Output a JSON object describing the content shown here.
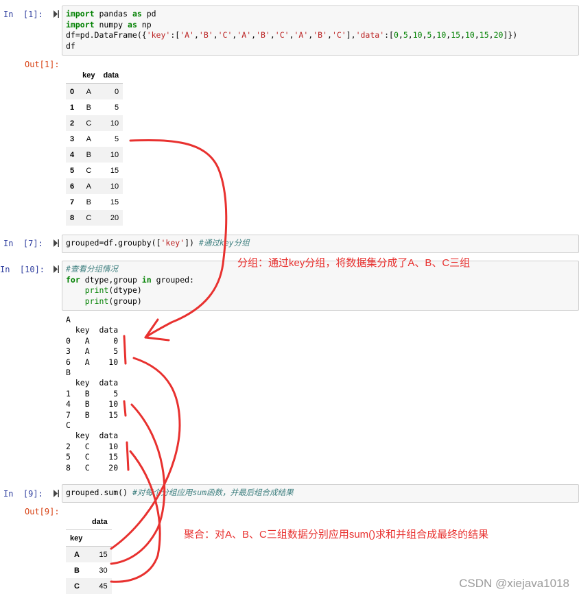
{
  "cells": [
    {
      "prompt": "In  [1]:",
      "code": [
        [
          [
            "kw",
            "import"
          ],
          [
            "t",
            " pandas "
          ],
          [
            "kw",
            "as"
          ],
          [
            "t",
            " pd"
          ]
        ],
        [
          [
            "kw",
            "import"
          ],
          [
            "t",
            " numpy "
          ],
          [
            "kw",
            "as"
          ],
          [
            "t",
            " np"
          ]
        ],
        [
          [
            "t",
            "df=pd.DataFrame({"
          ],
          [
            "str",
            "'key'"
          ],
          [
            "t",
            ":["
          ],
          [
            "str",
            "'A'"
          ],
          [
            "t",
            ","
          ],
          [
            "str",
            "'B'"
          ],
          [
            "t",
            ","
          ],
          [
            "str",
            "'C'"
          ],
          [
            "t",
            ","
          ],
          [
            "str",
            "'A'"
          ],
          [
            "t",
            ","
          ],
          [
            "str",
            "'B'"
          ],
          [
            "t",
            ","
          ],
          [
            "str",
            "'C'"
          ],
          [
            "t",
            ","
          ],
          [
            "str",
            "'A'"
          ],
          [
            "t",
            ","
          ],
          [
            "str",
            "'B'"
          ],
          [
            "t",
            ","
          ],
          [
            "str",
            "'C'"
          ],
          [
            "t",
            "],"
          ],
          [
            "str",
            "'data'"
          ],
          [
            "t",
            ":["
          ],
          [
            "num",
            "0"
          ],
          [
            "t",
            ","
          ],
          [
            "num",
            "5"
          ],
          [
            "t",
            ","
          ],
          [
            "num",
            "10"
          ],
          [
            "t",
            ","
          ],
          [
            "num",
            "5"
          ],
          [
            "t",
            ","
          ],
          [
            "num",
            "10"
          ],
          [
            "t",
            ","
          ],
          [
            "num",
            "15"
          ],
          [
            "t",
            ","
          ],
          [
            "num",
            "10"
          ],
          [
            "t",
            ","
          ],
          [
            "num",
            "15"
          ],
          [
            "t",
            ","
          ],
          [
            "num",
            "20"
          ],
          [
            "t",
            "]})"
          ]
        ],
        [
          [
            "t",
            "df"
          ]
        ]
      ]
    },
    {
      "prompt": "In  [7]:",
      "code": [
        [
          [
            "t",
            "grouped=df.groupby(["
          ],
          [
            "str",
            "'key'"
          ],
          [
            "t",
            "]) "
          ],
          [
            "cmt",
            "#通过key分组"
          ]
        ]
      ]
    },
    {
      "prompt": "In  [10]:",
      "code": [
        [
          [
            "cmt",
            "#查看分组情况"
          ]
        ],
        [
          [
            "kw",
            "for"
          ],
          [
            "t",
            " dtype,group "
          ],
          [
            "kw",
            "in"
          ],
          [
            "t",
            " grouped:"
          ]
        ],
        [
          [
            "t",
            "    "
          ],
          [
            "bi",
            "print"
          ],
          [
            "t",
            "(dtype)"
          ]
        ],
        [
          [
            "t",
            "    "
          ],
          [
            "bi",
            "print"
          ],
          [
            "t",
            "(group)"
          ]
        ]
      ]
    },
    {
      "prompt": "In  [9]:",
      "code": [
        [
          [
            "t",
            "grouped.sum() "
          ],
          [
            "cmt",
            "#对每个分组应用sum函数，并最后组合成结果"
          ]
        ]
      ]
    }
  ],
  "out1": {
    "prompt": "Out[1]:",
    "columns": [
      "key",
      "data"
    ],
    "rows": [
      [
        "0",
        "A",
        "0"
      ],
      [
        "1",
        "B",
        "5"
      ],
      [
        "2",
        "C",
        "10"
      ],
      [
        "3",
        "A",
        "5"
      ],
      [
        "4",
        "B",
        "10"
      ],
      [
        "5",
        "C",
        "15"
      ],
      [
        "6",
        "A",
        "10"
      ],
      [
        "7",
        "B",
        "15"
      ],
      [
        "8",
        "C",
        "20"
      ]
    ]
  },
  "out10": {
    "lines": [
      "A",
      "  key  data",
      "0   A     0",
      "3   A     5",
      "6   A    10",
      "B",
      "  key  data",
      "1   B     5",
      "4   B    10",
      "7   B    15",
      "C",
      "  key  data",
      "2   C    10",
      "5   C    15",
      "8   C    20"
    ]
  },
  "out9": {
    "prompt": "Out[9]:",
    "column": "data",
    "index_name": "key",
    "rows": [
      [
        "A",
        "15"
      ],
      [
        "B",
        "30"
      ],
      [
        "C",
        "45"
      ]
    ]
  },
  "annotations": {
    "group_note": "分组：通过key分组，将数据集分成了A、B、C三组",
    "agg_note": "聚合：对A、B、C三组数据分别应用sum()求和并组合成最终的结果"
  },
  "watermark": "CSDN @xiejava1018",
  "colors": {
    "in_prompt": "#303f9f",
    "out_prompt": "#d84315",
    "annotation": "#e8312f",
    "keyword": "#008000",
    "string": "#ba2121",
    "comment": "#408080"
  },
  "icons": [
    "run-cell-icon"
  ]
}
